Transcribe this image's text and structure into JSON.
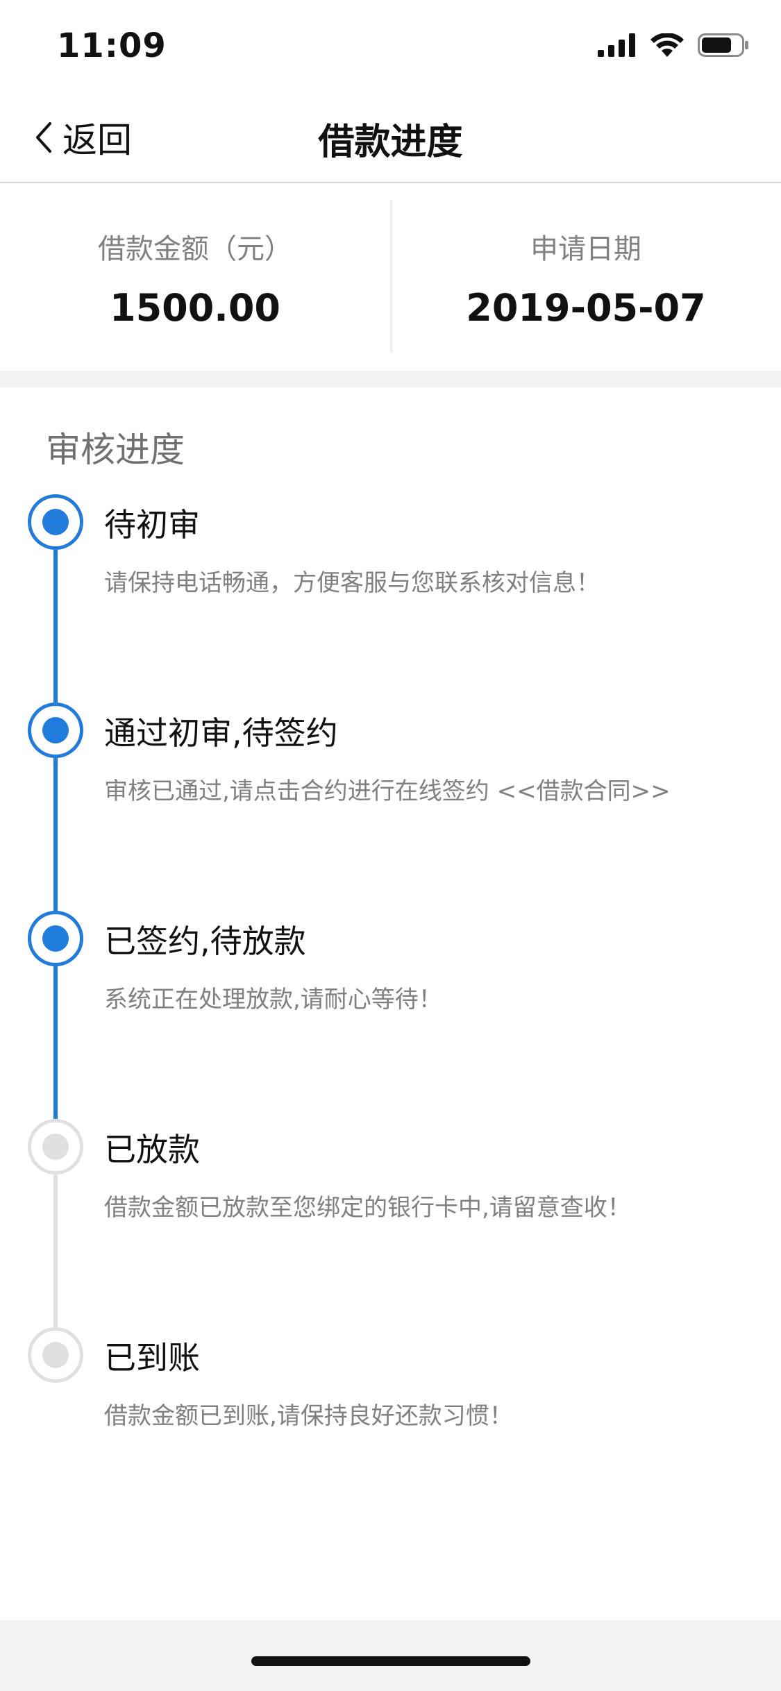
{
  "status_bar": {
    "time": "11:09"
  },
  "nav": {
    "back_label": "返回",
    "title": "借款进度"
  },
  "summary": {
    "amount_label": "借款金额（元）",
    "amount_value": "1500.00",
    "date_label": "申请日期",
    "date_value": "2019-05-07"
  },
  "progress": {
    "section_title": "审核进度",
    "steps": [
      {
        "title": "待初审",
        "desc": "请保持电话畅通，方便客服与您联系核对信息！",
        "status": "done"
      },
      {
        "title": "通过初审,待签约",
        "desc": "审核已通过,请点击合约进行在线签约 <<借款合同>>",
        "status": "done"
      },
      {
        "title": "已签约,待放款",
        "desc": "系统正在处理放款,请耐心等待！",
        "status": "done"
      },
      {
        "title": "已放款",
        "desc": "借款金额已放款至您绑定的银行卡中,请留意查收！",
        "status": "pending"
      },
      {
        "title": "已到账",
        "desc": "借款金额已到账,请保持良好还款习惯！",
        "status": "pending"
      }
    ]
  },
  "colors": {
    "accent": "#1f7bdc",
    "inactive": "#e0e0e0",
    "muted_text": "#808080"
  }
}
